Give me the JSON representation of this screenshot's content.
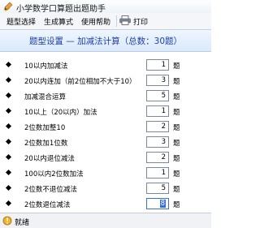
{
  "window": {
    "title": "小学数学口算题出题助手"
  },
  "menu": {
    "items": [
      {
        "label": "题型选择"
      },
      {
        "label": "生成算式"
      },
      {
        "label": "使用帮助"
      }
    ],
    "print_label": "打印"
  },
  "header": {
    "text": "题型设置 — 加减法计算（总数：30题）"
  },
  "unit": "题",
  "rows": [
    {
      "label": "10以内加减法",
      "value": "1"
    },
    {
      "label": "20以内连加（前2位相加不大于10）",
      "value": "3"
    },
    {
      "label": "加减混合运算",
      "value": "5"
    },
    {
      "label": "10以上（20以内）加法",
      "value": "1"
    },
    {
      "label": "2位数加整10",
      "value": "2"
    },
    {
      "label": "2位数加1位数",
      "value": "3"
    },
    {
      "label": "20以内退位减法",
      "value": "2"
    },
    {
      "label": "100以内2位数加法",
      "value": "1"
    },
    {
      "label": "2位数不退位减法",
      "value": "5"
    },
    {
      "label": "2位数退位减法",
      "value": "8"
    }
  ],
  "status": {
    "text": "就绪"
  },
  "colors": {
    "header_text": "#1d3fa8",
    "accent": "#3b6fd6"
  },
  "icons": {
    "app": "pencil-icon",
    "print": "printer-icon",
    "status": "status-icon"
  }
}
